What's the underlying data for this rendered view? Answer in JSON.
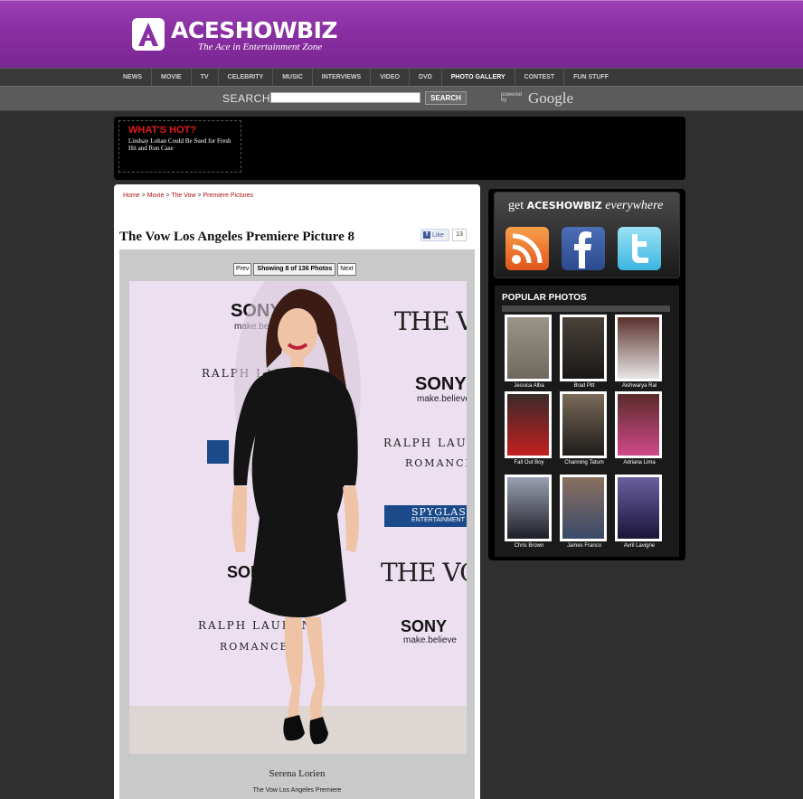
{
  "brand": {
    "name": "ACESHOWBIZ",
    "tagline": "The Ace in Entertainment Zone"
  },
  "nav": [
    {
      "label": "NEWS"
    },
    {
      "label": "MOVIE"
    },
    {
      "label": "TV"
    },
    {
      "label": "CELEBRITY"
    },
    {
      "label": "MUSIC"
    },
    {
      "label": "INTERVIEWS"
    },
    {
      "label": "VIDEO"
    },
    {
      "label": "DVD"
    },
    {
      "label": "PHOTO GALLERY",
      "active": true
    },
    {
      "label": "CONTEST"
    },
    {
      "label": "FUN STUFF"
    }
  ],
  "search": {
    "label": "SEARCH",
    "value": "",
    "button": "SEARCH",
    "powered_by": "powered by",
    "provider": "Google"
  },
  "hot": {
    "title": "WHAT'S HOT?",
    "headline": "Lindsay Lohan Could Be Sued for Fresh Hit and Run Case"
  },
  "breadcrumb": {
    "home": "Home",
    "movie": "Movie",
    "film": "The Vow",
    "section": "Premiere Pictures",
    "sep": ">"
  },
  "page": {
    "title": "The Vow Los Angeles Premiere Picture 8",
    "like_label": "Like",
    "like_count": "13"
  },
  "pager": {
    "prev": "Prev",
    "status": "Showing 8 of 136 Photos",
    "next": "Next"
  },
  "backdrop": {
    "sony": "SONY",
    "make_believe": "make.believe",
    "the_vow": "THE VOW",
    "ralph": "RALPH LAUREN",
    "romance": "ROMANCE",
    "spyglass": "SPYGLASS",
    "entertainment": "ENTERTAINMENT"
  },
  "caption": {
    "name": "Serena Lorien",
    "event": "The Vow Los Angeles Premiere"
  },
  "sidebar": {
    "get_prefix": "get",
    "get_brand": "ACESHOWBIZ",
    "get_suffix": "everywhere",
    "popular_title": "POPULAR PHOTOS",
    "photos": [
      {
        "name": "Jessica Alba",
        "color": "#8f8a7c"
      },
      {
        "name": "Brad Pitt",
        "color": "#2e2a26"
      },
      {
        "name": "Aishwarya Rai",
        "color": "#4a2c2a"
      },
      {
        "name": "Fall Out Boy",
        "color": "#b01a1a"
      },
      {
        "name": "Channing Tatum",
        "color": "#3a3430"
      },
      {
        "name": "Adriana Lima",
        "color": "#7a3a5a"
      },
      {
        "name": "Chris Brown",
        "color": "#6a7080"
      },
      {
        "name": "James Franco",
        "color": "#5a4a3a"
      },
      {
        "name": "Avril Lavigne",
        "color": "#3a3060"
      }
    ]
  },
  "colors": {
    "header": "#8a2fa3",
    "hot_title": "#e21b1b",
    "breadcrumb_link": "#b01010",
    "dress": "#111111"
  }
}
